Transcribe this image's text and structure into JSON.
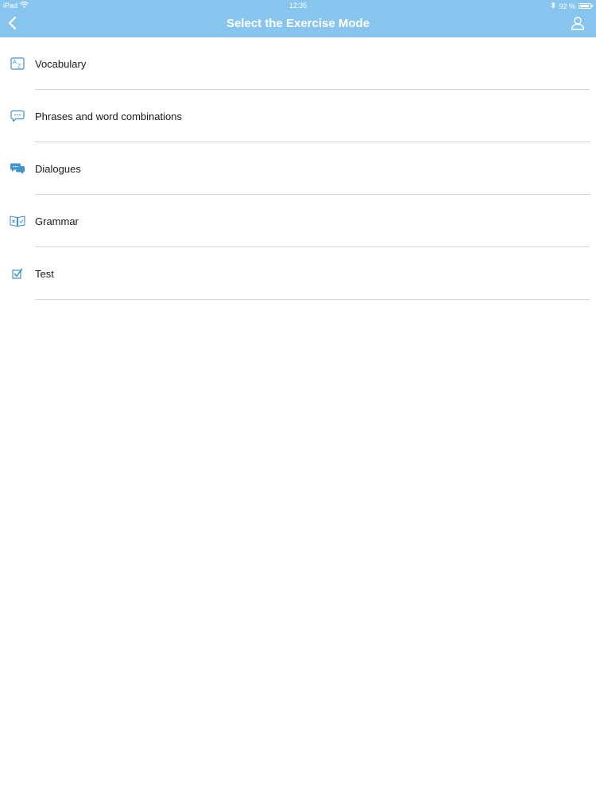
{
  "status_bar": {
    "device": "iPad",
    "time": "12:35",
    "battery_percent": "92 %",
    "battery_level": 0.92,
    "icons": [
      "wifi-icon",
      "bluetooth-icon",
      "battery-icon"
    ]
  },
  "navbar": {
    "title": "Select the Exercise Mode",
    "back_icon": "chevron-left-icon",
    "profile_icon": "user-icon"
  },
  "menu": {
    "items": [
      {
        "label": "Vocabulary",
        "icon": "az-dictionary-icon"
      },
      {
        "label": "Phrases and word combinations",
        "icon": "chat-bubble-icon"
      },
      {
        "label": "Dialogues",
        "icon": "dialogue-bubbles-icon"
      },
      {
        "label": "Grammar",
        "icon": "open-book-icon"
      },
      {
        "label": "Test",
        "icon": "checkbox-icon"
      }
    ]
  },
  "colors": {
    "header": "#87c5ee",
    "icon": "#3f93cf",
    "divider": "#d4d4d4"
  }
}
